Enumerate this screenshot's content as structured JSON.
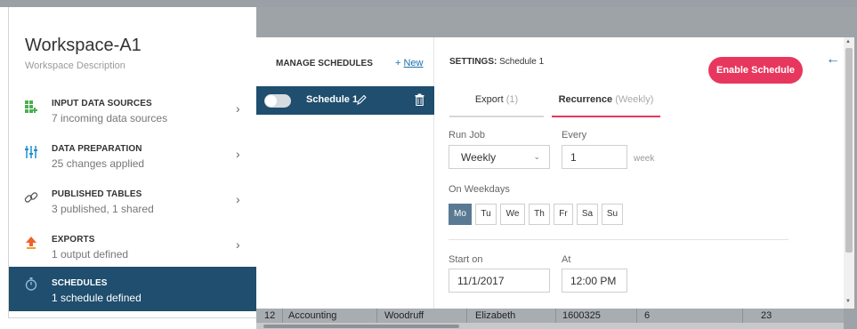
{
  "workspace": {
    "title": "Workspace-A1",
    "description": "Workspace Description"
  },
  "sidebar": {
    "items": [
      {
        "title": "INPUT DATA SOURCES",
        "subtitle": "7 incoming data sources",
        "icon": "grid-plus-icon"
      },
      {
        "title": "DATA PREPARATION",
        "subtitle": "25 changes applied",
        "icon": "sliders-icon"
      },
      {
        "title": "PUBLISHED TABLES",
        "subtitle": "3 published, 1 shared",
        "icon": "link-icon"
      },
      {
        "title": "EXPORTS",
        "subtitle": "1 output defined",
        "icon": "upload-arrow-icon"
      },
      {
        "title": "SCHEDULES",
        "subtitle": "1 schedule defined",
        "icon": "stopwatch-icon"
      }
    ],
    "chevron": "›"
  },
  "schedules": {
    "title": "MANAGE SCHEDULES",
    "new_plus": "+ ",
    "new_label": "New",
    "items": [
      {
        "name": "Schedule 1",
        "enabled": false
      }
    ]
  },
  "settings": {
    "label": "SETTINGS:",
    "name": "Schedule 1",
    "enable_button": "Enable Schedule",
    "back_arrow": "←",
    "tabs": [
      {
        "label": "Export",
        "count": "(1)"
      },
      {
        "label": "Recurrence",
        "count": "(Weekly)"
      }
    ],
    "run_job_label": "Run Job",
    "run_job_value": "Weekly",
    "every_label": "Every",
    "every_value": "1",
    "every_unit": "week",
    "weekdays_label": "On Weekdays",
    "weekdays": [
      "Mo",
      "Tu",
      "We",
      "Th",
      "Fr",
      "Sa",
      "Su"
    ],
    "selected_weekday": "Mo",
    "start_label": "Start on",
    "start_value": "11/1/2017",
    "at_label": "At",
    "at_value": "12:00 PM"
  },
  "table_row": [
    "12",
    "Accounting",
    "Woodruff",
    "Elizabeth",
    "1600325",
    "6",
    "23"
  ],
  "colors": {
    "active_nav": "#1f4e6e",
    "accent": "#e8375e",
    "selected_day": "#5a7a94",
    "link": "#1a6fb0"
  }
}
